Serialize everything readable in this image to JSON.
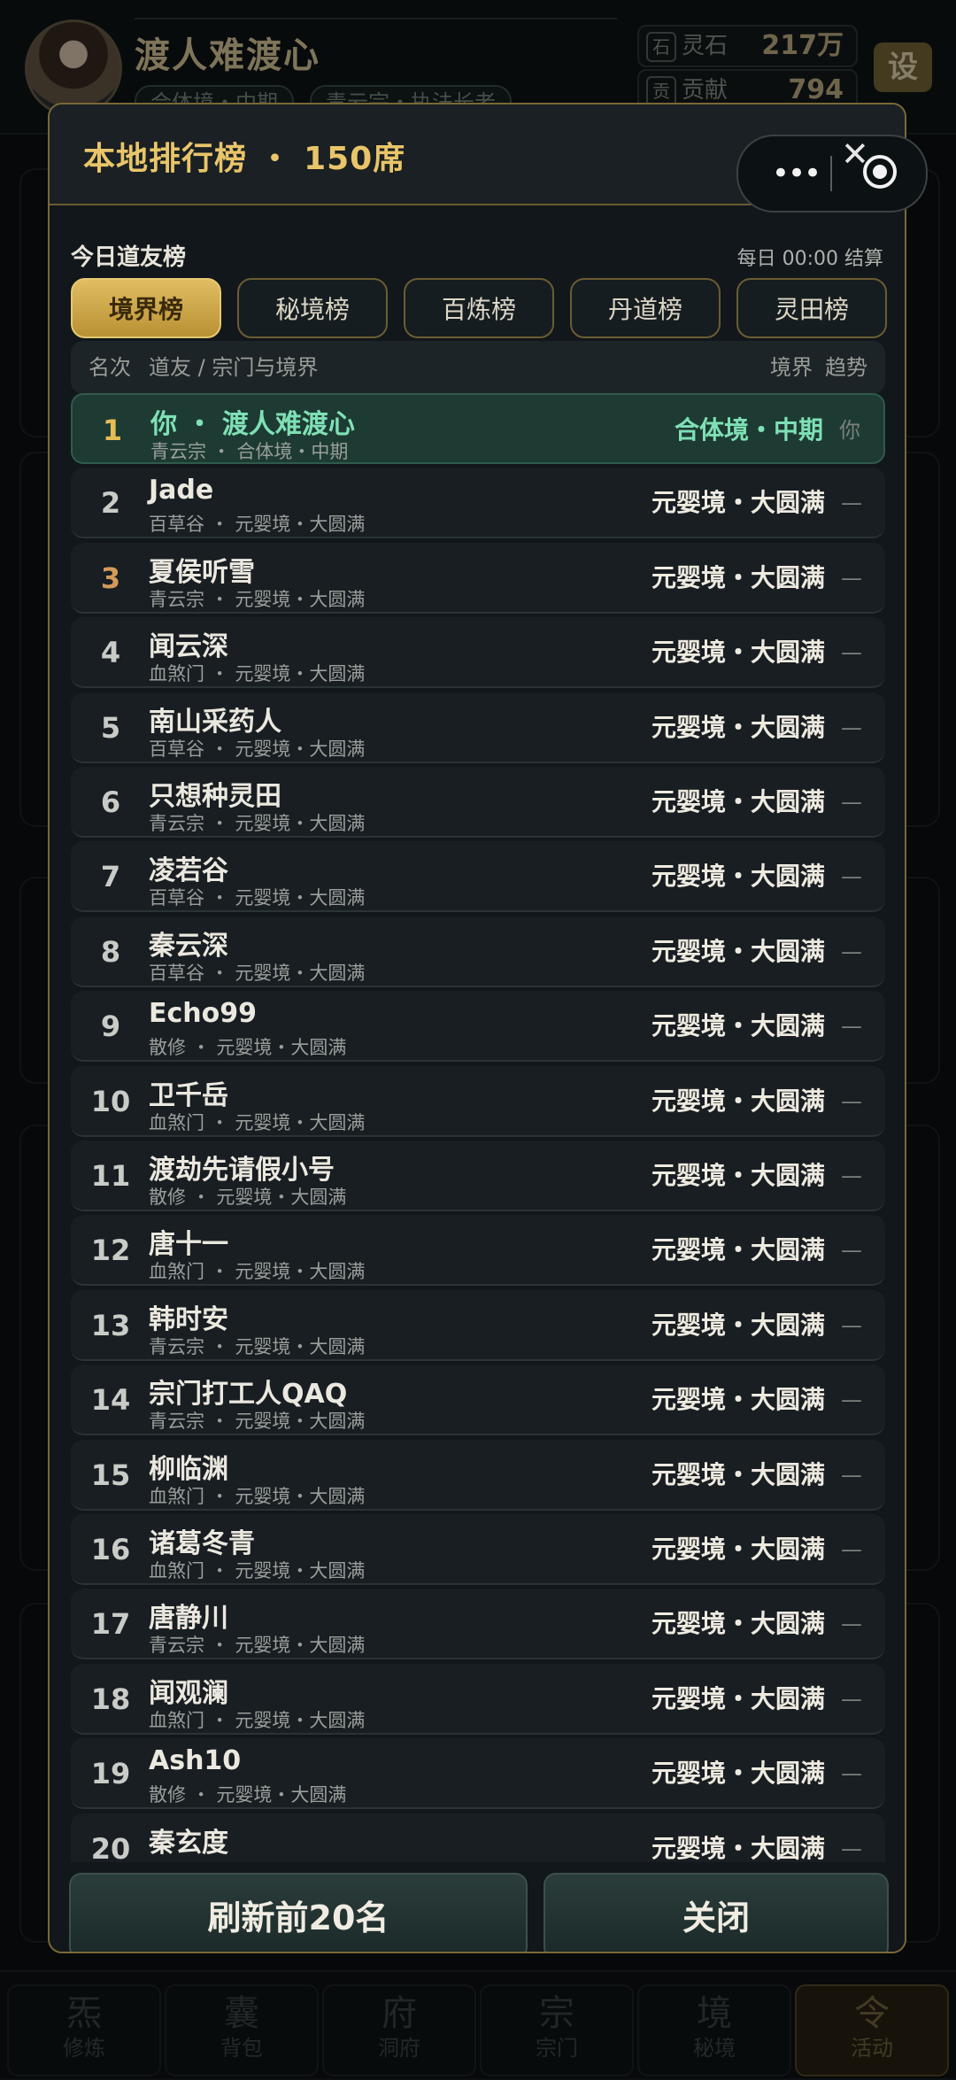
{
  "player": {
    "name": "渡人难渡心",
    "realm_chip": "合体境・中期",
    "sect_chip": "青云宗・执法长老",
    "resources": [
      {
        "icon": "石",
        "label": "灵石",
        "value": "217万"
      },
      {
        "icon": "贡",
        "label": "贡献",
        "value": "794"
      }
    ],
    "settings_label": "设"
  },
  "modal": {
    "title": "本地排行榜 ・ 150席",
    "section_title": "今日道友榜",
    "settle_note": "每日 00:00 结算",
    "tabs": [
      "境界榜",
      "秘境榜",
      "百炼榜",
      "丹道榜",
      "灵田榜"
    ],
    "active_tab": 0,
    "columns": {
      "rank": "名次",
      "player": "道友 / 宗门与境界",
      "realm": "境界",
      "trend": "趋势"
    },
    "rows": [
      {
        "rank": "1",
        "name": "你 ・ 渡人难渡心",
        "sub": "青云宗 ・ 合体境・中期",
        "realm": "合体境・中期",
        "trend": "你"
      },
      {
        "rank": "2",
        "name": "Jade",
        "sub": "百草谷 ・ 元婴境・大圆满",
        "realm": "元婴境・大圆满",
        "trend": "—"
      },
      {
        "rank": "3",
        "name": "夏侯听雪",
        "sub": "青云宗 ・ 元婴境・大圆满",
        "realm": "元婴境・大圆满",
        "trend": "—"
      },
      {
        "rank": "4",
        "name": "闻云深",
        "sub": "血煞门 ・ 元婴境・大圆满",
        "realm": "元婴境・大圆满",
        "trend": "—"
      },
      {
        "rank": "5",
        "name": "南山采药人",
        "sub": "百草谷 ・ 元婴境・大圆满",
        "realm": "元婴境・大圆满",
        "trend": "—"
      },
      {
        "rank": "6",
        "name": "只想种灵田",
        "sub": "青云宗 ・ 元婴境・大圆满",
        "realm": "元婴境・大圆满",
        "trend": "—"
      },
      {
        "rank": "7",
        "name": "凌若谷",
        "sub": "百草谷 ・ 元婴境・大圆满",
        "realm": "元婴境・大圆满",
        "trend": "—"
      },
      {
        "rank": "8",
        "name": "秦云深",
        "sub": "百草谷 ・ 元婴境・大圆满",
        "realm": "元婴境・大圆满",
        "trend": "—"
      },
      {
        "rank": "9",
        "name": "Echo99",
        "sub": "散修 ・ 元婴境・大圆满",
        "realm": "元婴境・大圆满",
        "trend": "—"
      },
      {
        "rank": "10",
        "name": "卫千岳",
        "sub": "血煞门 ・ 元婴境・大圆满",
        "realm": "元婴境・大圆满",
        "trend": "—"
      },
      {
        "rank": "11",
        "name": "渡劫先请假小号",
        "sub": "散修 ・ 元婴境・大圆满",
        "realm": "元婴境・大圆满",
        "trend": "—"
      },
      {
        "rank": "12",
        "name": "唐十一",
        "sub": "血煞门 ・ 元婴境・大圆满",
        "realm": "元婴境・大圆满",
        "trend": "—"
      },
      {
        "rank": "13",
        "name": "韩时安",
        "sub": "青云宗 ・ 元婴境・大圆满",
        "realm": "元婴境・大圆满",
        "trend": "—"
      },
      {
        "rank": "14",
        "name": "宗门打工人QAQ",
        "sub": "青云宗 ・ 元婴境・大圆满",
        "realm": "元婴境・大圆满",
        "trend": "—"
      },
      {
        "rank": "15",
        "name": "柳临渊",
        "sub": "血煞门 ・ 元婴境・大圆满",
        "realm": "元婴境・大圆满",
        "trend": "—"
      },
      {
        "rank": "16",
        "name": "诸葛冬青",
        "sub": "血煞门 ・ 元婴境・大圆满",
        "realm": "元婴境・大圆满",
        "trend": "—"
      },
      {
        "rank": "17",
        "name": "唐静川",
        "sub": "青云宗 ・ 元婴境・大圆满",
        "realm": "元婴境・大圆满",
        "trend": "—"
      },
      {
        "rank": "18",
        "name": "闻观澜",
        "sub": "血煞门 ・ 元婴境・大圆满",
        "realm": "元婴境・大圆满",
        "trend": "—"
      },
      {
        "rank": "19",
        "name": "Ash10",
        "sub": "散修 ・ 元婴境・大圆满",
        "realm": "元婴境・大圆满",
        "trend": "—"
      },
      {
        "rank": "20",
        "name": "秦玄度",
        "sub": "",
        "realm": "元婴境・大圆满",
        "trend": "—"
      }
    ],
    "refresh_button": "刷新前20名",
    "close_button": "关闭"
  },
  "capsule": {
    "more_icon": "more-dots-icon",
    "close_icon": "target-circle-icon",
    "dots": "•••"
  },
  "close_glyph": "✕",
  "bottom_nav": [
    {
      "glyph": "炁",
      "label": "修炼"
    },
    {
      "glyph": "囊",
      "label": "背包"
    },
    {
      "glyph": "府",
      "label": "洞府"
    },
    {
      "glyph": "宗",
      "label": "宗门"
    },
    {
      "glyph": "境",
      "label": "秘境"
    },
    {
      "glyph": "令",
      "label": "活动"
    }
  ]
}
